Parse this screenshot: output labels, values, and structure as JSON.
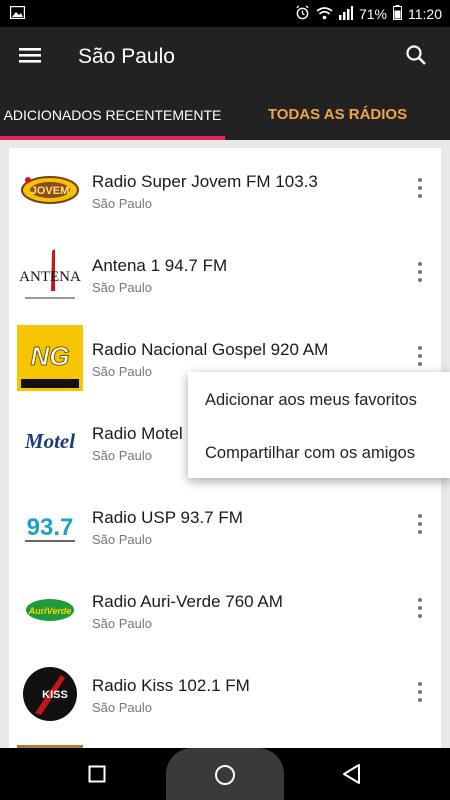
{
  "status_bar": {
    "battery": "71%",
    "time": "11:20"
  },
  "app_bar": {
    "title": "São Paulo"
  },
  "tabs": [
    {
      "label": "ADICIONADOS RECENTEMENTE",
      "selected": true
    },
    {
      "label": "TODAS AS RÁDIOS",
      "selected": false
    }
  ],
  "stations": [
    {
      "name": "Radio Super Jovem FM 103.3",
      "city": "São Paulo",
      "logo_text": "JOVEM"
    },
    {
      "name": "Antena 1 94.7 FM",
      "city": "São Paulo",
      "logo_text": "ANTENA"
    },
    {
      "name": "Radio Nacional Gospel 920 AM",
      "city": "São Paulo",
      "logo_text": "NG"
    },
    {
      "name": "Radio Motel",
      "city": "São Paulo",
      "logo_text": "Motel"
    },
    {
      "name": "Radio USP 93.7 FM",
      "city": "São Paulo",
      "logo_text": "93.7"
    },
    {
      "name": "Radio Auri-Verde 760 AM",
      "city": "São Paulo",
      "logo_text": "AuriVerde"
    },
    {
      "name": "Radio Kiss 102.1 FM",
      "city": "São Paulo",
      "logo_text": "KISS"
    }
  ],
  "popup_menu": {
    "items": [
      "Adicionar aos meus favoritos",
      "Compartilhar com os amigos"
    ]
  },
  "colors": {
    "app_bar": "#222222",
    "tab_indicator": "#e8235a",
    "tab_inactive": "#f0a44a"
  }
}
